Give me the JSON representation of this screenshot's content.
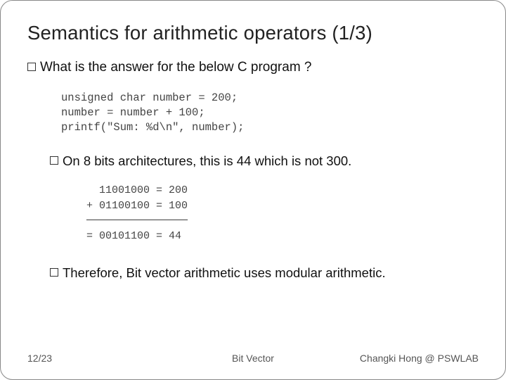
{
  "title": "Semantics for arithmetic operators (1/3)",
  "b1": "What is the answer for the below C program ?",
  "code": "unsigned char number = 200;\nnumber = number + 100;\nprintf(\"Sum: %d\\n\", number);",
  "b2a": "On 8 bits architectures, this is 44 which is not 300.",
  "math": "  11001000 = 200\n+ 01100100 = 100\n────────────────\n= 00101100 = 44",
  "b2b": "Therefore, Bit vector arithmetic uses modular arithmetic.",
  "footer": {
    "left": "12/23",
    "center": "Bit   Vector",
    "right": "Changki Hong @ PSWLAB"
  }
}
